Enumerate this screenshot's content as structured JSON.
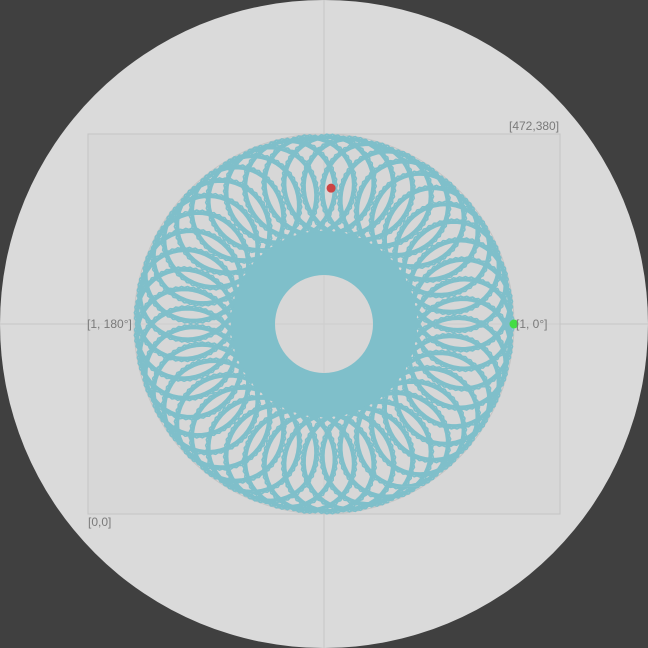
{
  "labels": {
    "top_right_corner": "[472,380]",
    "bottom_left_corner": "[0,0]",
    "left_axis": "[1, 180°]",
    "right_axis": "[1, 0°]"
  },
  "colors": {
    "background": "#404040",
    "disc": "#dadada",
    "rect": "#d5d5d5",
    "crosshair": "#c6c6c6",
    "curve": "#7fbfca",
    "green_marker": "#44dd44",
    "red_marker": "#cc4444"
  },
  "spiro": {
    "radius_ratio": 0.275,
    "cycles": 44,
    "green_angle_deg": 0,
    "red_angle_deg": 87
  }
}
